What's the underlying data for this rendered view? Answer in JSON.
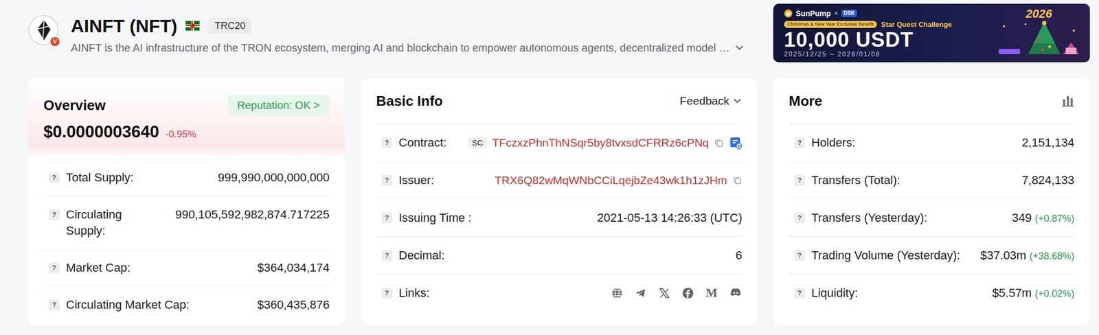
{
  "token": {
    "name": "AINFT (NFT)",
    "standard": "TRC20",
    "description": "AINFT is the AI infrastructure of the TRON ecosystem, merging AI and blockchain to empower autonomous agents, decentralized model …",
    "verified_mark": "V"
  },
  "banner": {
    "brand": "SunPump",
    "separator": "×",
    "partner": "DSK",
    "tagline": "Christmas & New Year Exclusive Benefit",
    "title": "Star Quest Challenge",
    "prize": "10,000 USDT",
    "dates": "2025/12/25 ~ 2026/01/08",
    "year": "2026"
  },
  "help_mark": "?",
  "overview": {
    "title": "Overview",
    "reputation": "Reputation: OK >",
    "price": "$0.0000003640",
    "change": "-0.95%",
    "rows": [
      {
        "label": "Total Supply:",
        "value": "999,990,000,000,000"
      },
      {
        "label": "Circulating Supply:",
        "value": "990,105,592,982,874.717225"
      },
      {
        "label": "Market Cap:",
        "value": "$364,034,174"
      },
      {
        "label": "Circulating Market Cap:",
        "value": "$360,435,876"
      }
    ]
  },
  "basic_info": {
    "title": "Basic Info",
    "feedback": "Feedback",
    "rows": [
      {
        "kind": "contract",
        "label": "Contract:",
        "badge": "SC",
        "value": "TFczxzPhnThNSqr5by8tvxsdCFRRz6cPNq"
      },
      {
        "kind": "address",
        "label": "Issuer:",
        "value": "TRX6Q82wMqWNbCCiLqejbZe43wk1h1zJHm"
      },
      {
        "kind": "text",
        "label": "Issuing Time :",
        "value": "2021-05-13 14:26:33 (UTC)"
      },
      {
        "kind": "text",
        "label": "Decimal:",
        "value": "6"
      },
      {
        "kind": "links",
        "label": "Links:"
      }
    ],
    "links": [
      {
        "kind": "website"
      },
      {
        "kind": "telegram"
      },
      {
        "kind": "x"
      },
      {
        "kind": "facebook"
      },
      {
        "kind": "medium",
        "glyph": "M"
      },
      {
        "kind": "discord"
      }
    ]
  },
  "more": {
    "title": "More",
    "rows": [
      {
        "label": "Holders:",
        "value": "2,151,134"
      },
      {
        "label": "Transfers (Total):",
        "value": "7,824,133"
      },
      {
        "label": "Transfers (Yesterday):",
        "value": "349",
        "change": "(+0.87%)"
      },
      {
        "label": "Trading Volume (Yesterday):",
        "value": "$37.03m",
        "change": "(+38.68%)"
      },
      {
        "label": "Liquidity:",
        "value": "$5.57m",
        "change": "(+0.02%)"
      }
    ]
  }
}
